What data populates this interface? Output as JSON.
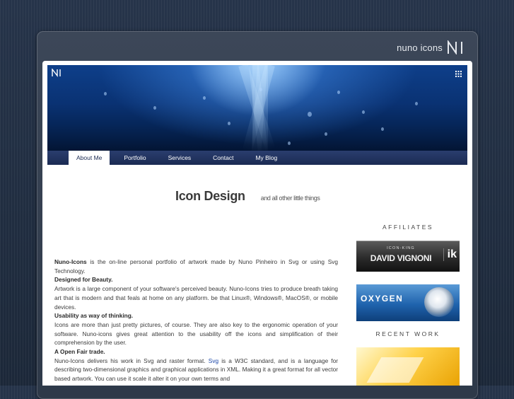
{
  "brand": {
    "name": "nuno icons"
  },
  "menu": {
    "items": [
      "About Me",
      "Portfolio",
      "Services",
      "Contact",
      "My Blog"
    ],
    "active": "About Me"
  },
  "headline": {
    "title": "Icon Design",
    "subtitle": "and all other little things"
  },
  "content": {
    "p1_bold": "Nuno-Icons",
    "p1_rest": " is the on-line personal portfolio of artwork made by Nuno Pinheiro in Svg or using Svg Technology.",
    "h2": "Designed for Beauty.",
    "p2": "Artwork is a large component of your software's perceived beauty. Nuno-Icons tries to produce breath taking art that is modern and that feals at home on any platform. be that Linux®, Windows®, MacOS®, or mobile devices.",
    "h3": "Usability as way of thinking.",
    "p3": "Icons are more than just pretty pictures, of course. They are also key to the ergonomic operation of your software. Nuno-icons gives great attention to the usability off the icons and simplification of their comprehension by the user.",
    "h4": "A Open Fair trade.",
    "p4_before": "Nuno-Icons delivers his work in Svg and raster format. ",
    "p4_link": "Svg",
    "p4_after": " is a W3C standard, and is a language for describing two-dimensional graphics and graphical applications in XML. Making it a great format for all vector based artwork. You can use it scale it alter it on your own terms and"
  },
  "sidebar": {
    "affiliates_title": "AFFILIATES",
    "affiliate1": {
      "small": "ICON-KING",
      "name": "DAVID VIGNONI",
      "mark": "ik"
    },
    "affiliate2": {
      "name": "OXYGEN"
    },
    "recent_work_title": "RECENT WORK"
  }
}
